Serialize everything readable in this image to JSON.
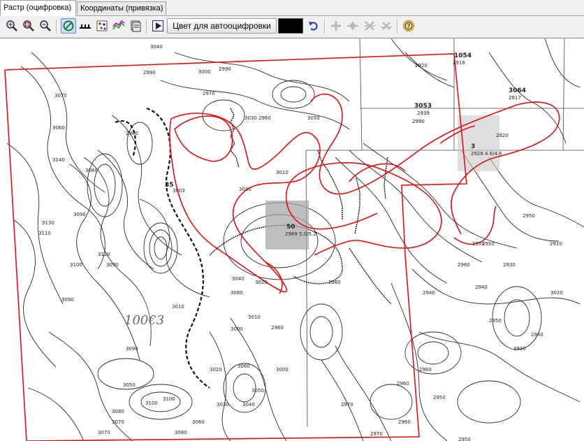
{
  "tabs": [
    {
      "label": "Растр (оцифровка)",
      "active": true
    },
    {
      "label": "Координаты (привязка)",
      "active": false
    }
  ],
  "toolbar": {
    "icons": [
      "zoom-in-icon",
      "zoom-rect-icon",
      "zoom-out-icon",
      "no-entry-icon",
      "digitize-contour-icon",
      "digitize-points-icon",
      "digitize-fault-icon",
      "layers-icon",
      "play-icon",
      "undo-icon",
      "add-point-icon",
      "move-point-icon",
      "delete-point-icon",
      "delete-line-icon",
      "help-icon"
    ],
    "autodigitize_color_label": "Цвет для автооцифровки >>",
    "autodigitize_color": "#000000",
    "accent_color": "#e01010"
  },
  "map": {
    "contour_labels": [
      "3070",
      "3040",
      "2990",
      "3000",
      "3060",
      "3030",
      "3080",
      "3090",
      "3030",
      "3090",
      "3100",
      "2960",
      "2980",
      "3000",
      "2970",
      "3010",
      "2950",
      "2960",
      "2920",
      "2940",
      "2950",
      "2910",
      "2990",
      "2960",
      "2920",
      "2930",
      "3020",
      "3050",
      "3010",
      "3040",
      "3080",
      "3090",
      "3100",
      "3070",
      "3060",
      "3110",
      "3130",
      "3120",
      "3140",
      "3050",
      "3080",
      "2980",
      "2990",
      "3010",
      "3020",
      "2970",
      "2950",
      "2960",
      "2940",
      "2930",
      "2950",
      "2960",
      "2970",
      "2950",
      "2960",
      "3020",
      "3030",
      "3040",
      "2960",
      "3060",
      "3070",
      "3080",
      "3050",
      "3000",
      "3100",
      "3090",
      "2950"
    ],
    "well_labels": [
      {
        "name": "3053",
        "values": "2939"
      },
      {
        "name": "3064",
        "values": "2917"
      },
      {
        "name": "1054",
        "values": "2916"
      },
      {
        "name": "35",
        "values": "3003"
      },
      {
        "name": "50",
        "values": "2989 5.0/5.2"
      },
      {
        "name": "3",
        "values": "2928 4.6/4.6"
      }
    ],
    "handwritten_label": "100€3"
  }
}
